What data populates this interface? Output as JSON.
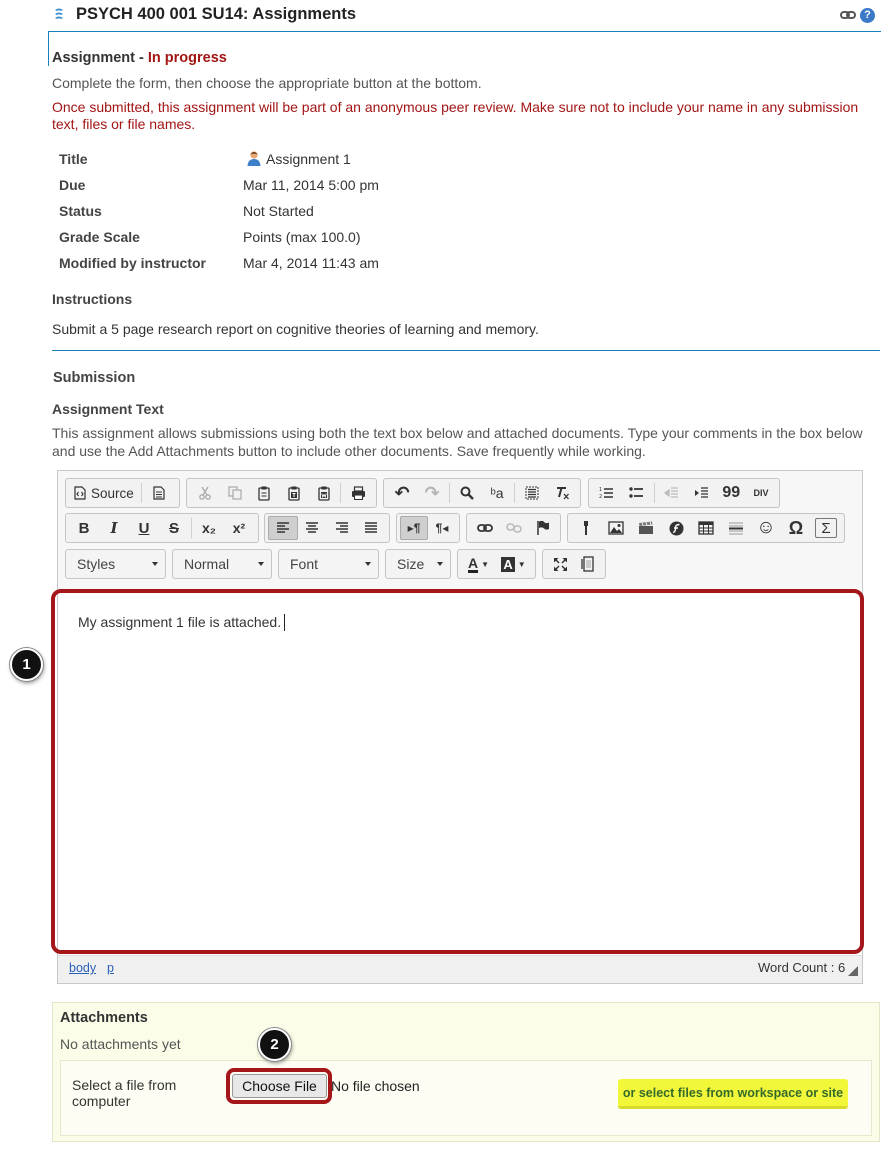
{
  "header": {
    "title": "PSYCH 400 001 SU14: Assignments",
    "help_glyph": "?"
  },
  "assignment": {
    "heading_prefix": "Assignment - ",
    "heading_status": "In progress",
    "instruction_line": "Complete the form, then choose the appropriate button at the bottom.",
    "warning": "Once submitted, this assignment will be part of an anonymous peer review. Make sure not to include your name in any submission text, files or file names.",
    "details": [
      {
        "label": "Title",
        "value": "Assignment 1"
      },
      {
        "label": "Due",
        "value": "Mar 11, 2014 5:00 pm"
      },
      {
        "label": "Status",
        "value": "Not Started"
      },
      {
        "label": "Grade Scale",
        "value": "Points (max 100.0)"
      },
      {
        "label": "Modified by instructor",
        "value": "Mar 4, 2014 11:43 am"
      }
    ],
    "instructions_heading": "Instructions",
    "instructions_text": "Submit a 5 page research report on cognitive theories of learning and memory."
  },
  "submission": {
    "heading": "Submission",
    "text_heading": "Assignment Text",
    "description": "This assignment allows submissions using both the text box below and attached documents. Type your comments in the box below and use the Add Attachments button to include other documents. Save frequently while working."
  },
  "editor": {
    "source_label": "Source",
    "combos": {
      "styles": "Styles",
      "format": "Normal",
      "font": "Font",
      "size": "Size"
    },
    "glyphs": {
      "bold": "B",
      "italic": "I",
      "underline": "U",
      "strike": "S",
      "subscript": "x₂",
      "superscript": "x²",
      "ltr": "▸¶",
      "rtl": "¶◂",
      "blockquote": "99",
      "div": "DIV",
      "omega": "Ω",
      "sigma": "Σ",
      "smiley": "☺",
      "undo": "↶",
      "redo": "↷",
      "find": "⌕",
      "replace": "ᵇa",
      "text_color": "A",
      "bg_color": "A"
    },
    "content": "My assignment 1 file is attached.",
    "path": [
      "body",
      "p"
    ],
    "word_count": "Word Count : 6"
  },
  "callouts": [
    "1",
    "2"
  ],
  "attachments": {
    "heading": "Attachments",
    "empty_text": "No attachments yet",
    "select_label": "Select a file from computer",
    "choose_button": "Choose File",
    "no_file": "No file chosen",
    "workspace_button": "or select files from workspace or site"
  },
  "colors": {
    "accent": "#1a84b8",
    "status": "#a31515",
    "highlight": "#a4161a",
    "workspace_button": "#f2f73a"
  }
}
